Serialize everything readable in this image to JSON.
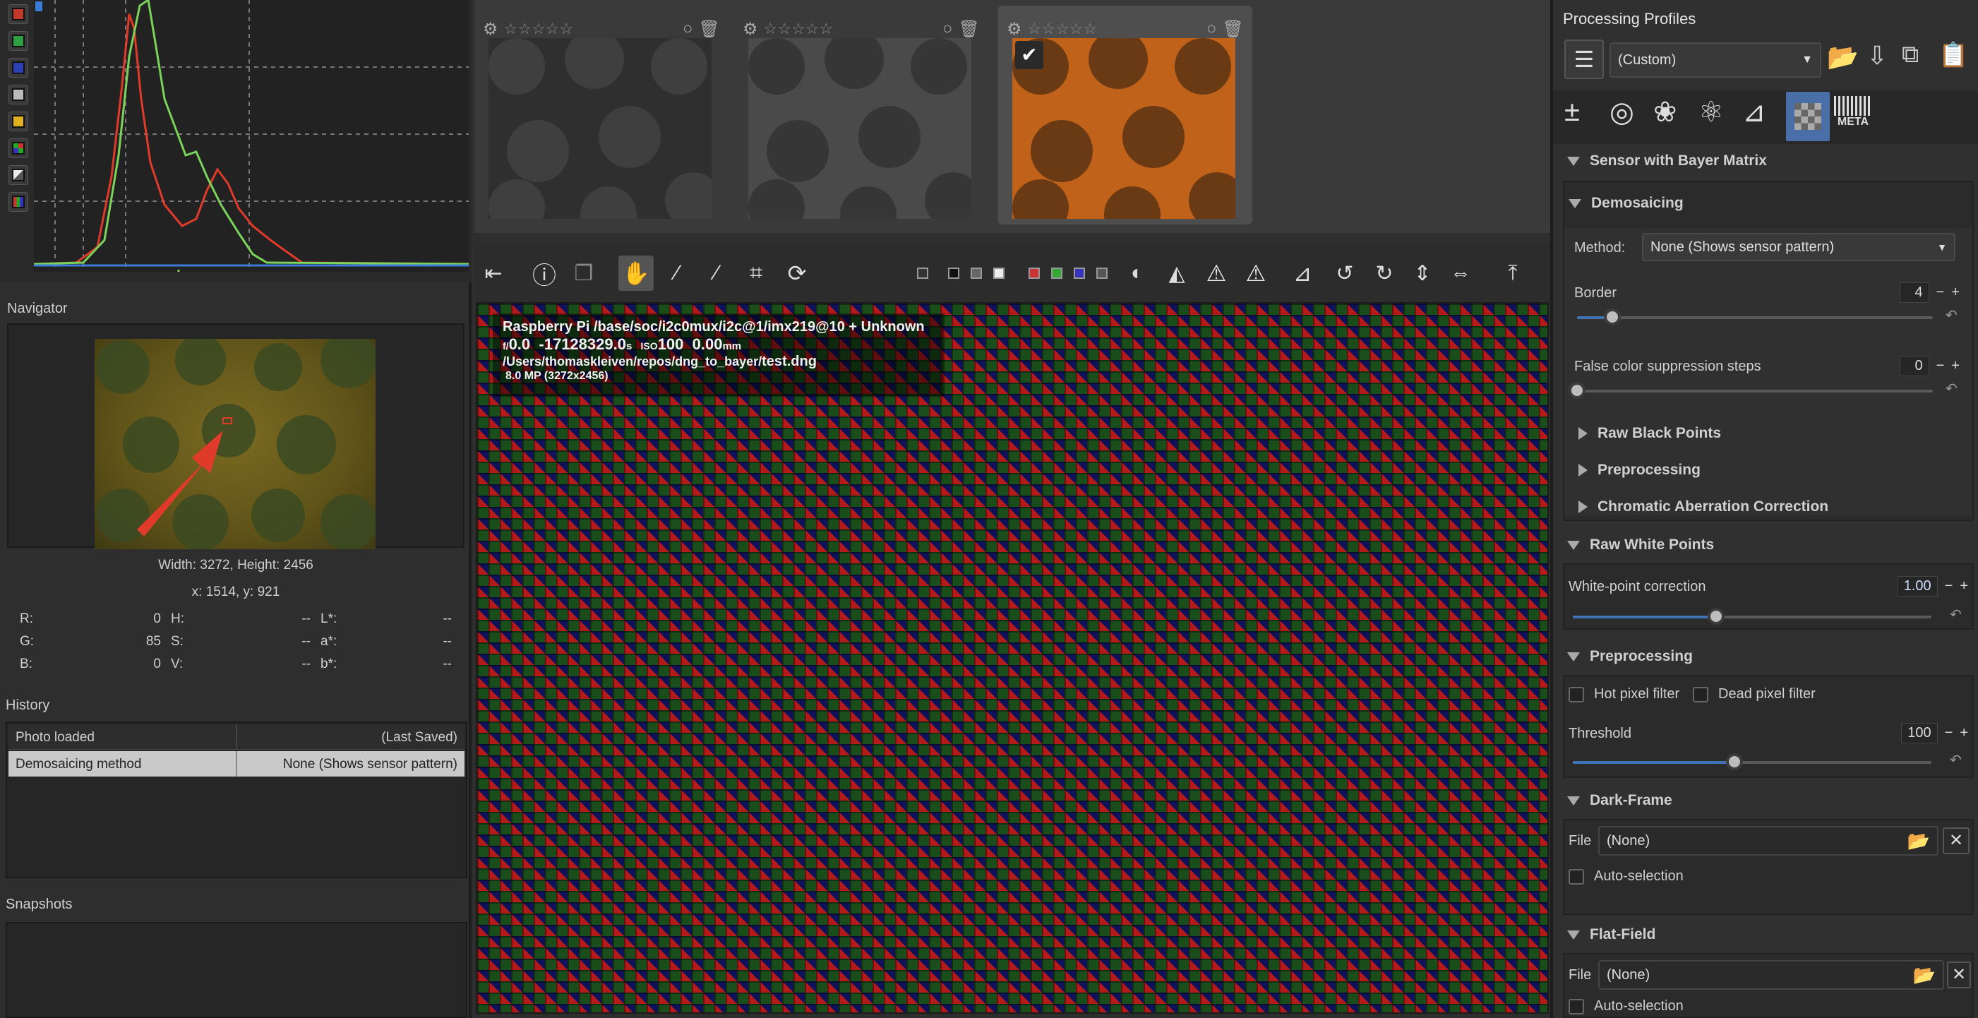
{
  "histogram": {
    "channel_buttons": [
      {
        "name": "red-channel",
        "color": "#c0392b"
      },
      {
        "name": "green-channel",
        "color": "#27ae3f"
      },
      {
        "name": "blue-channel",
        "color": "#2c3fb5"
      },
      {
        "name": "luminance",
        "color": "#bbbbbb"
      },
      {
        "name": "raw",
        "color": "#e0b020"
      },
      {
        "name": "bayer",
        "color": "#999999"
      },
      {
        "name": "mode",
        "color": "#aaaaaa"
      },
      {
        "name": "waveform",
        "color": "#aaaaaa"
      }
    ]
  },
  "navigator": {
    "title": "Navigator",
    "dimensions": "Width: 3272, Height: 2456",
    "coords": "x: 1514, y: 921",
    "values": [
      {
        "label": "R:",
        "value": "0",
        "label2": "H:",
        "value2": "--",
        "label3": "L*:",
        "value3": "--"
      },
      {
        "label": "G:",
        "value": "85",
        "label2": "S:",
        "value2": "--",
        "label3": "a*:",
        "value3": "--"
      },
      {
        "label": "B:",
        "value": "0",
        "label2": "V:",
        "value2": "--",
        "label3": "b*:",
        "value3": "--"
      }
    ]
  },
  "history": {
    "title": "History",
    "rows": [
      {
        "action": "Photo loaded",
        "value": "(Last Saved)"
      },
      {
        "action": "Demosaicing method",
        "value": "None (Shows sensor pattern)"
      }
    ]
  },
  "snapshots": {
    "title": "Snapshots"
  },
  "filmstrip": {
    "thumbs": [
      {
        "selected": false
      },
      {
        "selected": false
      },
      {
        "selected": true
      }
    ]
  },
  "image_info": {
    "camera": "Raspberry Pi /base/soc/i2c0mux/i2c@1/imx219@10 + Unknown",
    "f": "f/",
    "aperture": "0.0",
    "shutter": "-17128329.0",
    "shutter_unit": "s",
    "iso_label": "ISO",
    "iso": "100",
    "focal": "0.00",
    "focal_unit": "mm",
    "path_prefix": "/Users/thomaskleiven/repos/dng_to_bayer/",
    "filename": "test.dng",
    "megapixels": "8.0 MP (3272x2456)"
  },
  "profiles": {
    "title": "Processing Profiles",
    "selected": "(Custom)"
  },
  "tool_tabs": [
    "exposure",
    "detail",
    "color",
    "advanced",
    "transform",
    "raw",
    "metadata"
  ],
  "tool_tab_meta": "META",
  "sections": {
    "sensor_title": "Sensor with Bayer Matrix",
    "demosaicing": {
      "title": "Demosaicing",
      "method_label": "Method:",
      "method_value": "None (Shows sensor pattern)",
      "border_label": "Border",
      "border_value": "4",
      "border_level": 0.1,
      "fcs_label": "False color suppression steps",
      "fcs_value": "0",
      "fcs_level": 0
    },
    "collapsed": [
      "Raw Black Points",
      "Preprocessing",
      "Chromatic Aberration Correction"
    ],
    "raw_white_points": {
      "title": "Raw White Points",
      "label": "White-point correction",
      "value": "1.00",
      "level": 0.4
    },
    "preprocessing": {
      "title": "Preprocessing",
      "hot_pixel": "Hot pixel filter",
      "dead_pixel": "Dead pixel filter",
      "threshold_label": "Threshold",
      "threshold_value": "100",
      "threshold_level": 0.45
    },
    "dark_frame": {
      "title": "Dark-Frame",
      "file_label": "File",
      "file_value": "(None)",
      "auto": "Auto-selection"
    },
    "flat_field": {
      "title": "Flat-Field",
      "file_label": "File",
      "file_value": "(None)",
      "auto": "Auto-selection"
    }
  },
  "colors": {
    "accent": "#3f73b5",
    "arrow": "#e03a2a"
  }
}
